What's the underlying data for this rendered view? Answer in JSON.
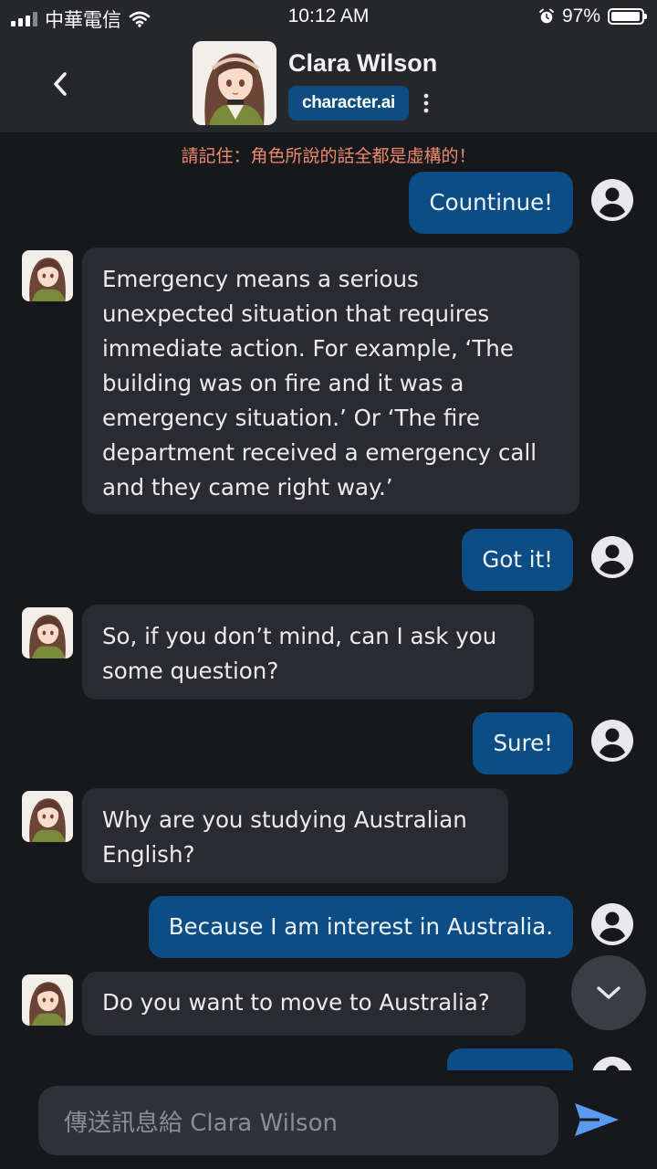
{
  "status_bar": {
    "carrier": "中華電信",
    "time": "10:12 AM",
    "battery_percent": "97%",
    "battery_level": 0.97
  },
  "header": {
    "character_name": "Clara Wilson",
    "brand_label": "character.ai"
  },
  "disclaimer": "請記住：角色所說的話全都是虛構的！",
  "messages": [
    {
      "role": "user",
      "text": "Countinue!"
    },
    {
      "role": "bot",
      "lines": [
        "Emergency means a serious",
        "unexpected situation that requires",
        "immediate action. For example, ‘The",
        "building was on fire and it was a",
        "emergency situation.’ Or ‘The fire",
        "department received a emergency call",
        "and they came right way.’"
      ]
    },
    {
      "role": "user",
      "text": "Got it!"
    },
    {
      "role": "bot",
      "lines": [
        "So, if you don’t mind, can I ask you",
        "some question?"
      ]
    },
    {
      "role": "user",
      "text": "Sure!"
    },
    {
      "role": "bot",
      "lines": [
        "Why are you studying Australian",
        "English?"
      ]
    },
    {
      "role": "user",
      "text": "Because I am interest in Australia."
    },
    {
      "role": "bot",
      "lines": [
        "Do you want to move to Australia?"
      ]
    }
  ],
  "composer": {
    "placeholder": "傳送訊息給 Clara Wilson"
  },
  "colors": {
    "background": "#17181c",
    "header": "#26272b",
    "user_bubble": "#0c4d85",
    "bot_bubble": "#2a2b30",
    "brand_badge": "#0f4c81",
    "disclaimer": "#f08a6e",
    "send_icon": "#5a9bf0"
  },
  "icons": {
    "back": "chevron-left-icon",
    "more": "more-vertical-icon",
    "user_avatar": "user-circle-icon",
    "scroll_down": "chevron-down-icon",
    "send": "send-icon"
  }
}
